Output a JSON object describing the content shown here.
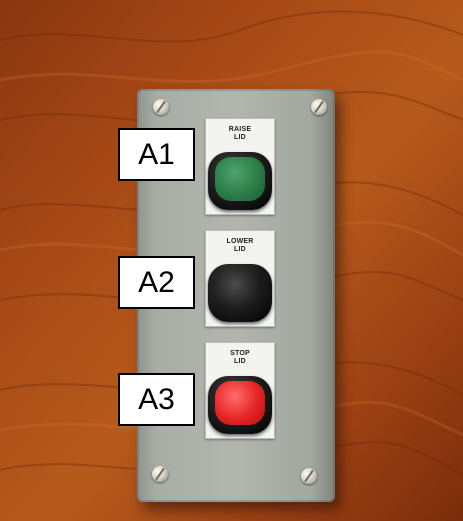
{
  "colors": {
    "wood_base": "#9b4313",
    "wood_light": "#bd6420",
    "wood_dark": "#6a2409",
    "box_body": "#acb0aa",
    "button_green": "#2c7d48",
    "button_black": "#1c1c1c",
    "button_red": "#e52525"
  },
  "callouts": [
    {
      "label": "A1"
    },
    {
      "label": "A2"
    },
    {
      "label": "A3"
    }
  ],
  "buttons": [
    {
      "legend": "RAISE\nLID",
      "color": "green"
    },
    {
      "legend": "LOWER\nLID",
      "color": "black"
    },
    {
      "legend": "STOP\nLID",
      "color": "red"
    }
  ]
}
